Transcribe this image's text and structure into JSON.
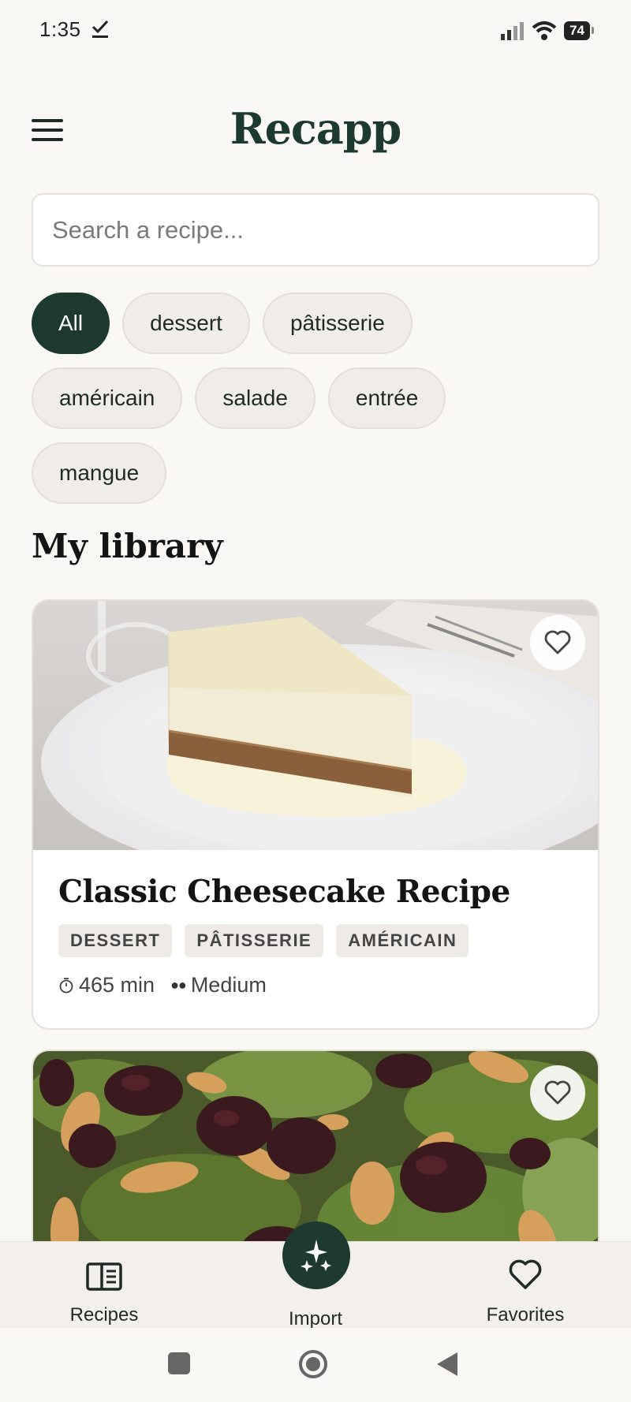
{
  "status": {
    "time": "1:35",
    "battery": "74"
  },
  "app": {
    "title": "Recapp"
  },
  "search": {
    "placeholder": "Search a recipe..."
  },
  "filters": {
    "row1": [
      "All",
      "dessert",
      "pâtisserie"
    ],
    "row2": [
      "américain",
      "salade",
      "entrée"
    ],
    "row3": [
      "mangue"
    ],
    "active": "All"
  },
  "library": {
    "title": "My library",
    "recipes": [
      {
        "title": "Classic Cheesecake Recipe",
        "tags": [
          "DESSERT",
          "PÂTISSERIE",
          "AMÉRICAIN"
        ],
        "time": "465 min",
        "difficulty": "Medium",
        "favorite": false
      },
      {
        "favorite": false
      }
    ]
  },
  "nav": {
    "recipes": "Recipes",
    "import": "Import",
    "favorites": "Favorites"
  },
  "colors": {
    "primary": "#1d3a30",
    "background": "#faf8f4",
    "chip": "#f0ede8"
  }
}
